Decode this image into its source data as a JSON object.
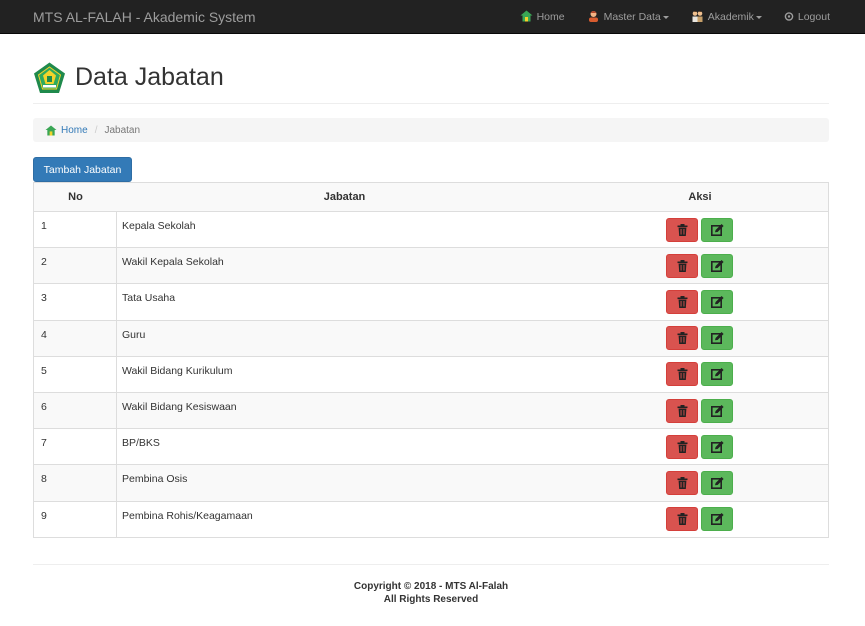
{
  "navbar": {
    "brand": "MTS AL-FALAH - Akademic System",
    "items": [
      {
        "label": "Home",
        "icon": "home-icon",
        "caret": false
      },
      {
        "label": "Master Data",
        "icon": "user-icon",
        "caret": true
      },
      {
        "label": "Akademik",
        "icon": "students-icon",
        "caret": true
      },
      {
        "label": "Logout",
        "icon": "power-icon",
        "caret": false
      }
    ]
  },
  "header": {
    "title": "Data Jabatan"
  },
  "breadcrumb": {
    "home": "Home",
    "current": "Jabatan"
  },
  "add_button": "Tambah Jabatan",
  "table": {
    "headers": {
      "no": "No",
      "jabatan": "Jabatan",
      "aksi": "Aksi"
    },
    "rows": [
      {
        "no": "1",
        "jabatan": "Kepala Sekolah"
      },
      {
        "no": "2",
        "jabatan": "Wakil Kepala Sekolah"
      },
      {
        "no": "3",
        "jabatan": "Tata Usaha"
      },
      {
        "no": "4",
        "jabatan": "Guru"
      },
      {
        "no": "5",
        "jabatan": "Wakil Bidang Kurikulum"
      },
      {
        "no": "6",
        "jabatan": "Wakil Bidang Kesiswaan"
      },
      {
        "no": "7",
        "jabatan": "BP/BKS"
      },
      {
        "no": "8",
        "jabatan": "Pembina Osis"
      },
      {
        "no": "9",
        "jabatan": "Pembina Rohis/Keagamaan"
      }
    ]
  },
  "footer": {
    "line1": "Copyright © 2018 - MTS Al-Falah",
    "line2": "All Rights Reserved"
  },
  "colors": {
    "navbar": "#222222",
    "primary": "#337ab7",
    "danger": "#d9534f",
    "success": "#5cb85c"
  }
}
